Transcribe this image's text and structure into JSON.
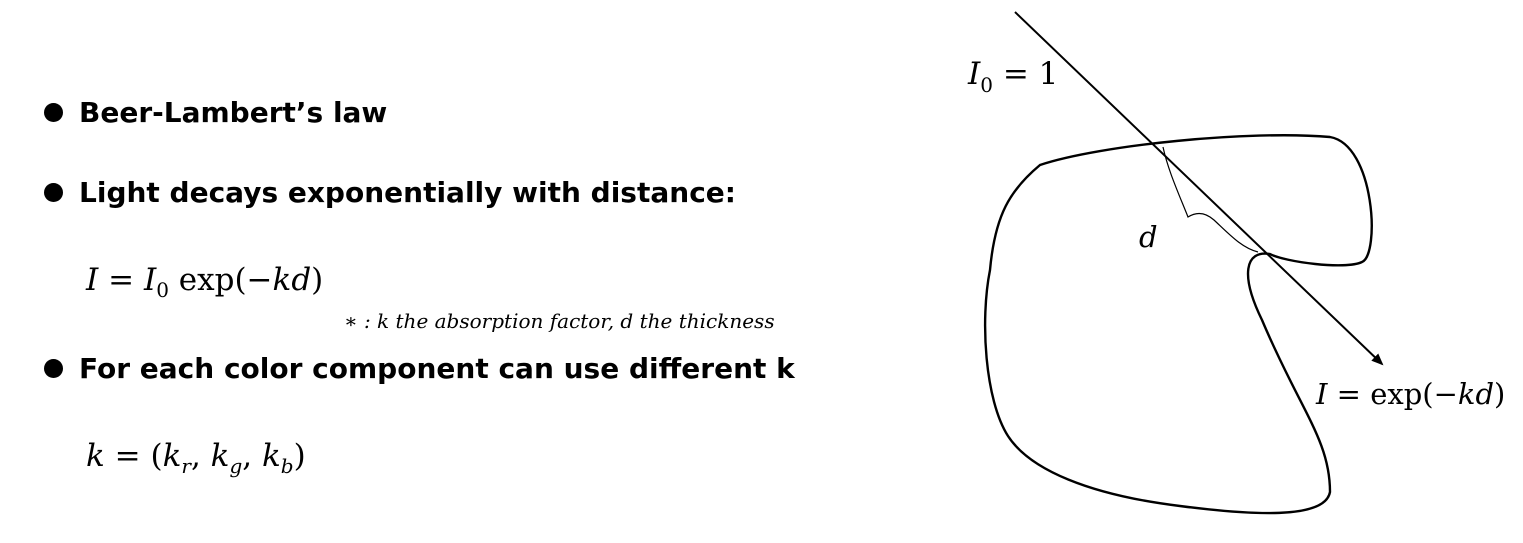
{
  "bullets": [
    "Beer-Lambert’s law",
    "Light decays exponentially with distance:",
    "For each color component can use different k"
  ],
  "equations": {
    "decay": {
      "lhs": "I",
      "equals": " = ",
      "i0_base": "I",
      "i0_sub": "0",
      "func": " exp(−",
      "vars": "kd",
      "close": ")"
    },
    "note": "∗ : k the absorption factor, d the thickness",
    "components": {
      "lhs": "k",
      "rest": " = (",
      "kr": "k",
      "r": "r",
      "kg": "k",
      "g": "g",
      "kb": "k",
      "b": "b",
      "sep": ", ",
      "close": ")"
    }
  },
  "diagram": {
    "incident_label": {
      "base": "I",
      "sub": "0",
      "rest": " = 1"
    },
    "thickness_label": "d",
    "exit_label": {
      "lhs": "I",
      "rest": " = exp(−",
      "vars": "kd",
      "close": ")"
    }
  }
}
